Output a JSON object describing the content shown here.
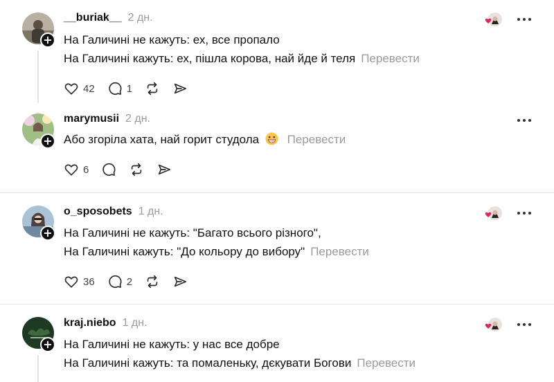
{
  "posts": [
    {
      "username": "__buriak__",
      "time": "2 дн.",
      "lines": [
        "На Галичині не кажуть: ех, все пропало",
        "На Галичині кажуть: ех, пішла корова, най йде й теля"
      ],
      "translate": "Перевести",
      "likes": "42",
      "replies": "1",
      "avatar_color": "#8a8070"
    },
    {
      "username": "marymusii",
      "time": "2 дн.",
      "lines": [
        "Або згоріла хата, най горит студола"
      ],
      "emoji": "grinning-face-emoji",
      "translate": "Перевести",
      "likes": "6",
      "replies": "",
      "avatar_color": "#6f8f5a"
    },
    {
      "username": "o_sposobets",
      "time": "1 дн.",
      "lines": [
        "На Галичині не кажуть: \"Багато всього різного\",",
        "На Галичині кажуть: \"До кольору до вибору\""
      ],
      "translate": "Перевести",
      "likes": "36",
      "replies": "2",
      "avatar_color": "#8fa6b8"
    },
    {
      "username": "kraj.niebo",
      "time": "1 дн.",
      "lines": [
        "На Галичині не кажуть: у нас все добре",
        "На Галичині кажуть: та помаленьку, дєкувати Богови"
      ],
      "translate": "Перевести",
      "avatar_color": "#1f3a24"
    }
  ],
  "colors": {
    "text": "#101010",
    "muted": "#9a9a9a",
    "divider": "#e3e3e3",
    "heart": "#e0245e"
  },
  "icons": [
    "heart-icon",
    "comment-icon",
    "repost-icon",
    "share-icon",
    "more-icon",
    "plus-icon"
  ]
}
